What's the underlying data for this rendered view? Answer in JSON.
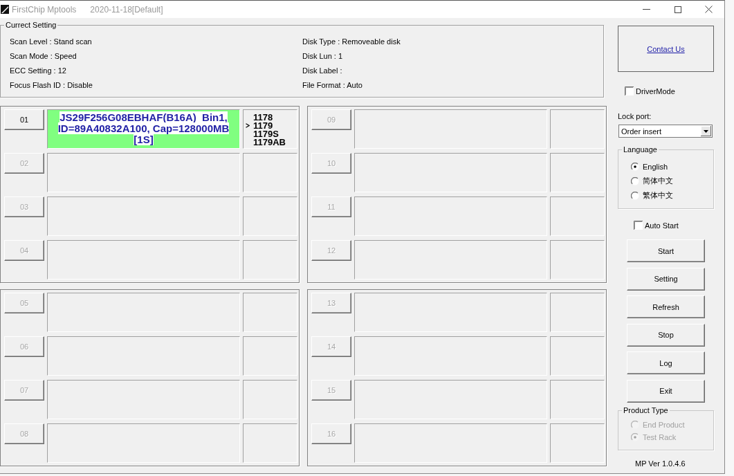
{
  "window": {
    "title": "FirstChip Mptools",
    "build": "2020-11-18[Default]"
  },
  "current_setting": {
    "title": "Currect Setting",
    "columns": [
      [
        "Scan Level : Stand scan",
        "Scan Mode : Speed",
        "ECC Setting : 12",
        "Focus Flash ID : Disable"
      ],
      [
        "Disk Type : Removeable disk",
        "Disk Lun : 1",
        "Disk Label :",
        "File Format : Auto"
      ]
    ]
  },
  "port_groups": [
    {
      "ports": [
        {
          "label": "01",
          "disabled": false,
          "color": "#80ff80",
          "info": [
            "JS29F256G08EBHAF(B16A)  Bin1,",
            "ID=89A40832A100, Cap=128000MB",
            "[1S]"
          ],
          "versions": [
            {
              "label": "1178",
              "selected": false
            },
            {
              "label": "1179",
              "selected": true
            },
            {
              "label": "1179S",
              "selected": false
            },
            {
              "label": "1179AB",
              "selected": false
            }
          ]
        },
        {
          "label": "02",
          "disabled": true
        },
        {
          "label": "03",
          "disabled": true
        },
        {
          "label": "04",
          "disabled": true
        }
      ]
    },
    {
      "ports": [
        {
          "label": "09",
          "disabled": true
        },
        {
          "label": "10",
          "disabled": true
        },
        {
          "label": "11",
          "disabled": true
        },
        {
          "label": "12",
          "disabled": true
        }
      ]
    },
    {
      "ports": [
        {
          "label": "05",
          "disabled": true
        },
        {
          "label": "06",
          "disabled": true
        },
        {
          "label": "07",
          "disabled": true
        },
        {
          "label": "08",
          "disabled": true
        }
      ]
    },
    {
      "ports": [
        {
          "label": "13",
          "disabled": true
        },
        {
          "label": "14",
          "disabled": true
        },
        {
          "label": "15",
          "disabled": true
        },
        {
          "label": "16",
          "disabled": true
        }
      ]
    }
  ],
  "contact_link": "Contact Us",
  "driver_mode": {
    "label": "DriverMode",
    "checked": false
  },
  "lock_port": {
    "label": "Lock port:",
    "value": "Order insert"
  },
  "language": {
    "title": "Language",
    "options": [
      {
        "label": "English",
        "selected": true
      },
      {
        "label": "简体中文",
        "selected": false
      },
      {
        "label": "繁体中文",
        "selected": false
      }
    ]
  },
  "auto_start": {
    "label": "Auto Start",
    "checked": false
  },
  "buttons": [
    "Start",
    "Setting",
    "Refresh",
    "Stop",
    "Log",
    "Exit"
  ],
  "product_type": {
    "title": "Product Type",
    "disabled": true,
    "options": [
      {
        "label": "End Product",
        "selected": false
      },
      {
        "label": "Test Rack",
        "selected": true
      }
    ]
  },
  "version": "MP Ver 1.0.4.6"
}
